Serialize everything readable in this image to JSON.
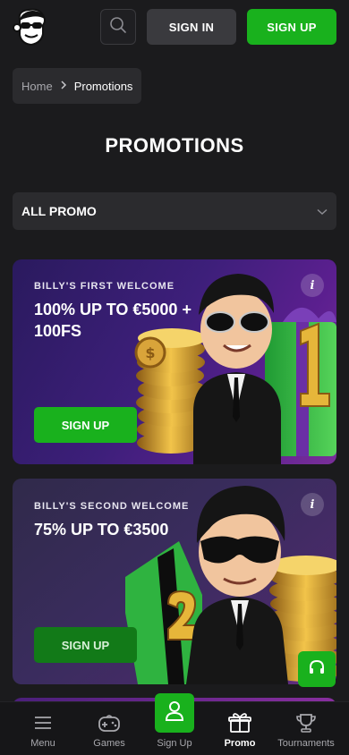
{
  "header": {
    "signin_label": "SIGN IN",
    "signup_label": "SIGN UP",
    "brand_color": "#19b11d"
  },
  "breadcrumb": {
    "home": "Home",
    "current": "Promotions"
  },
  "page_title": "PROMOTIONS",
  "filter": {
    "selected": "ALL PROMO"
  },
  "promos": [
    {
      "eyebrow": "BILLY'S FIRST WELCOME",
      "headline_line1": "100% UP TO €5000 +",
      "headline_line2": "100FS",
      "cta": "SIGN UP",
      "info": "i"
    },
    {
      "eyebrow": "BILLY'S SECOND WELCOME",
      "headline_line1": "75% UP TO €3500",
      "cta": "SIGN UP",
      "info": "i"
    }
  ],
  "bottom_nav": [
    {
      "label": "Menu",
      "icon": "hamburger-icon"
    },
    {
      "label": "Games",
      "icon": "gamepad-icon"
    },
    {
      "label": "Sign Up",
      "icon": "user-icon"
    },
    {
      "label": "Promo",
      "icon": "gift-icon",
      "active": true
    },
    {
      "label": "Tournaments",
      "icon": "trophy-icon"
    }
  ]
}
